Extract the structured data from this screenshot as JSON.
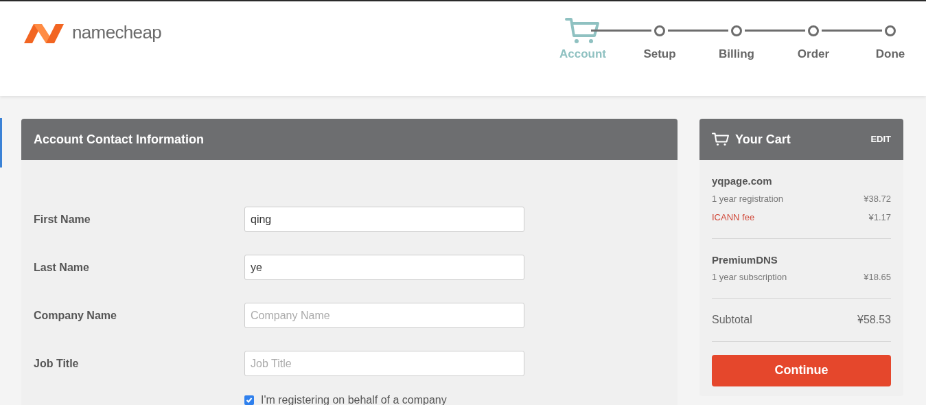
{
  "logo": {
    "text": "namecheap"
  },
  "steps": [
    {
      "label": "Account",
      "selected": true
    },
    {
      "label": "Setup",
      "selected": false
    },
    {
      "label": "Billing",
      "selected": false
    },
    {
      "label": "Order",
      "selected": false
    },
    {
      "label": "Done",
      "selected": false
    }
  ],
  "form": {
    "title": "Account Contact Information",
    "fields": [
      {
        "label": "First Name",
        "value": "qing"
      },
      {
        "label": "Last Name",
        "value": "ye"
      },
      {
        "label": "Company Name",
        "placeholder": "Company Name"
      },
      {
        "label": "Job Title",
        "placeholder": "Job Title"
      }
    ],
    "company_checkbox": {
      "label": "I'm registering on behalf of a company",
      "checked": true
    }
  },
  "cart": {
    "title": "Your Cart",
    "edit": "EDIT",
    "items": [
      {
        "name": "yqpage.com",
        "lines": [
          {
            "kind": "normal",
            "label": "1 year registration",
            "price": "¥38.72"
          },
          {
            "kind": "fee",
            "label": "ICANN fee",
            "price": "¥1.17"
          }
        ]
      },
      {
        "name": "PremiumDNS",
        "lines": [
          {
            "kind": "normal",
            "label": "1 year subscription",
            "price": "¥18.65"
          }
        ]
      }
    ],
    "subtotal_label": "Subtotal",
    "subtotal": "¥58.53",
    "button": "Continue"
  }
}
